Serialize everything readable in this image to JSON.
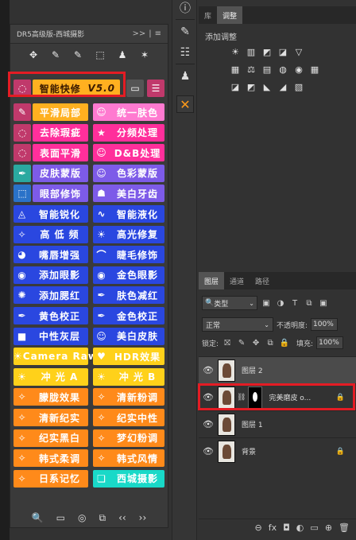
{
  "dr5": {
    "title": "DR5高级版-西城摄影",
    "header_controls": [
      ">>",
      "|",
      "≡"
    ],
    "tools": [
      "✥",
      "✎",
      "✎",
      "⬚",
      "♟",
      "✶"
    ],
    "featured": {
      "label": "智能快修",
      "version": "V5.0"
    },
    "rows": [
      {
        "left": {
          "label": "平滑局部",
          "color": "#ffb020",
          "icon": "brush-icon"
        },
        "right": {
          "label": "统一肤色",
          "color": "#ff7ad0",
          "icon": "face-icon"
        }
      },
      {
        "left": {
          "label": "去除瑕疵",
          "color": "#ff2f9b",
          "icon": "lasso-icon"
        },
        "right": {
          "label": "分频处理",
          "color": "#ff2f9b",
          "icon": "star-icon"
        }
      },
      {
        "left": {
          "label": "表面平滑",
          "color": "#ff2f9b",
          "icon": "lasso-icon"
        },
        "right": {
          "label": "D&B处理",
          "color": "#ff2f9b",
          "icon": "face-icon"
        }
      },
      {
        "left": {
          "label": "皮肤蒙版",
          "color": "#7d5be8",
          "icon": "dropper-icon"
        },
        "right": {
          "label": "色彩蒙版",
          "color": "#7d5be8",
          "icon": "face-icon"
        }
      },
      {
        "left": {
          "label": "眼部修饰",
          "color": "#7d5be8",
          "icon": "select-icon"
        },
        "right": {
          "label": "美白牙齿",
          "color": "#7d5be8",
          "icon": "tooth-icon"
        }
      },
      {
        "left": {
          "label": "智能锐化",
          "color": "#2a47e0",
          "icon": "triangle-icon"
        },
        "right": {
          "label": "智能液化",
          "color": "#2a47e0",
          "icon": "wave-icon"
        }
      },
      {
        "left": {
          "label": "高 低 频",
          "color": "#2a47e0",
          "icon": "wand-icon"
        },
        "right": {
          "label": "高光修复",
          "color": "#2a47e0",
          "icon": "sun-icon"
        }
      },
      {
        "left": {
          "label": "嘴唇增强",
          "color": "#2a47e0",
          "icon": "lips-icon"
        },
        "right": {
          "label": "睫毛修饰",
          "color": "#2a47e0",
          "icon": "lash-icon"
        }
      },
      {
        "left": {
          "label": "添加眼影",
          "color": "#2a47e0",
          "icon": "eye-icon"
        },
        "right": {
          "label": "金色眼影",
          "color": "#2a47e0",
          "icon": "eye-icon"
        }
      },
      {
        "left": {
          "label": "添加腮红",
          "color": "#2a47e0",
          "icon": "blush-icon"
        },
        "right": {
          "label": "肤色减红",
          "color": "#2a47e0",
          "icon": "dropper-icon"
        }
      },
      {
        "left": {
          "label": "黄色校正",
          "color": "#2a47e0",
          "icon": "dropper-icon"
        },
        "right": {
          "label": "金色校正",
          "color": "#2a47e0",
          "icon": "dropper-icon"
        }
      },
      {
        "left": {
          "label": "中性灰层",
          "color": "#2a47e0",
          "icon": "square-icon"
        },
        "right": {
          "label": "美白皮肤",
          "color": "#2a47e0",
          "icon": "face-icon"
        }
      },
      {
        "left": {
          "label": "Camera Raw",
          "color": "#ffd11a",
          "icon": "sun-icon"
        },
        "right": {
          "label": "HDR效果",
          "color": "#ffd11a",
          "icon": "heart-icon"
        }
      },
      {
        "left": {
          "label": "冲 光 A",
          "color": "#ffd11a",
          "icon": "sun-icon"
        },
        "right": {
          "label": "冲 光 B",
          "color": "#ffd11a",
          "icon": "sun-icon"
        }
      },
      {
        "left": {
          "label": "朦胧效果",
          "color": "#ff8a1a",
          "icon": "wand-icon"
        },
        "right": {
          "label": "清新粉调",
          "color": "#ff8a1a",
          "icon": "wand-icon"
        }
      },
      {
        "left": {
          "label": "清新纪实",
          "color": "#ff8a1a",
          "icon": "wand-icon"
        },
        "right": {
          "label": "纪实中性",
          "color": "#ff8a1a",
          "icon": "wand-icon"
        }
      },
      {
        "left": {
          "label": "纪实黑白",
          "color": "#ff8a1a",
          "icon": "wand-icon"
        },
        "right": {
          "label": "梦幻粉调",
          "color": "#ff8a1a",
          "icon": "wand-icon"
        }
      },
      {
        "left": {
          "label": "韩式柔调",
          "color": "#ff8a1a",
          "icon": "wand-icon"
        },
        "right": {
          "label": "韩式风情",
          "color": "#ff8a1a",
          "icon": "wand-icon"
        }
      },
      {
        "left": {
          "label": "日系记忆",
          "color": "#ff8a1a",
          "icon": "wand-icon"
        },
        "right": {
          "label": "西城摄影",
          "color": "#19d9c8",
          "icon": "logo-icon"
        }
      }
    ],
    "left_icon_colors": [
      "#c0396b",
      "#c0396b",
      "#c0396b",
      "#2aa9a0",
      "#2a72c8"
    ],
    "bottom_icons": [
      "🔍",
      "▭",
      "◎",
      "⧉",
      "‹‹",
      "››"
    ]
  },
  "adjust": {
    "tabs": [
      "库",
      "调整"
    ],
    "active_tab": "调整",
    "label": "添加调整",
    "row1": [
      "☀",
      "▥",
      "◩",
      "◪",
      "▽"
    ],
    "row2": [
      "▦",
      "⚖",
      "▤",
      "◍",
      "◉",
      "▦"
    ],
    "row3": [
      "◪",
      "◩",
      "◣",
      "◢",
      "▧"
    ]
  },
  "layers": {
    "tabs": [
      "图层",
      "通道",
      "路径"
    ],
    "active_tab": "图层",
    "kind": "类型",
    "filter_icons": [
      "▣",
      "◑",
      "T",
      "⧉",
      "▣"
    ],
    "blend_mode": "正常",
    "opacity_label": "不透明度:",
    "opacity": "100%",
    "lock_label": "锁定:",
    "lock_icons": [
      "⛝",
      "✎",
      "✥",
      "⧉",
      "🔒"
    ],
    "fill_label": "填充:",
    "fill": "100%",
    "items": [
      {
        "name": "图层 2",
        "selected": true,
        "mask": false,
        "locked": false
      },
      {
        "name": "完美磨皮 o...",
        "selected": false,
        "mask": true,
        "locked": true
      },
      {
        "name": "图层 1",
        "selected": false,
        "mask": false,
        "locked": false
      },
      {
        "name": "背景",
        "selected": false,
        "mask": false,
        "locked": true
      }
    ],
    "bottom_icons": [
      "⊖",
      "fx",
      "◘",
      "◐",
      "▭",
      "⊕",
      "🗑"
    ]
  }
}
